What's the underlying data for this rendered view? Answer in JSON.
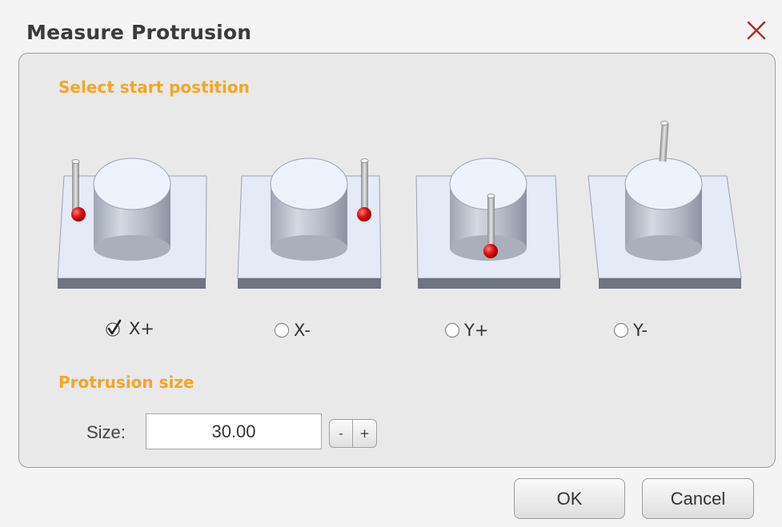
{
  "dialog": {
    "title": "Measure Protrusion",
    "close_icon": "close-icon"
  },
  "start_position": {
    "heading": "Select start postition",
    "options": [
      {
        "label": "X+",
        "selected": true
      },
      {
        "label": "X-",
        "selected": false
      },
      {
        "label": "Y+",
        "selected": false
      },
      {
        "label": "Y-",
        "selected": false
      }
    ]
  },
  "protrusion": {
    "heading": "Protrusion size",
    "size_label": "Size:",
    "size_value": "30.00",
    "minus_label": "-",
    "plus_label": "+"
  },
  "footer": {
    "ok_label": "OK",
    "cancel_label": "Cancel"
  },
  "colors": {
    "accent": "#f5a623",
    "close": "#b0302a",
    "probe_ball": "#e01010"
  }
}
